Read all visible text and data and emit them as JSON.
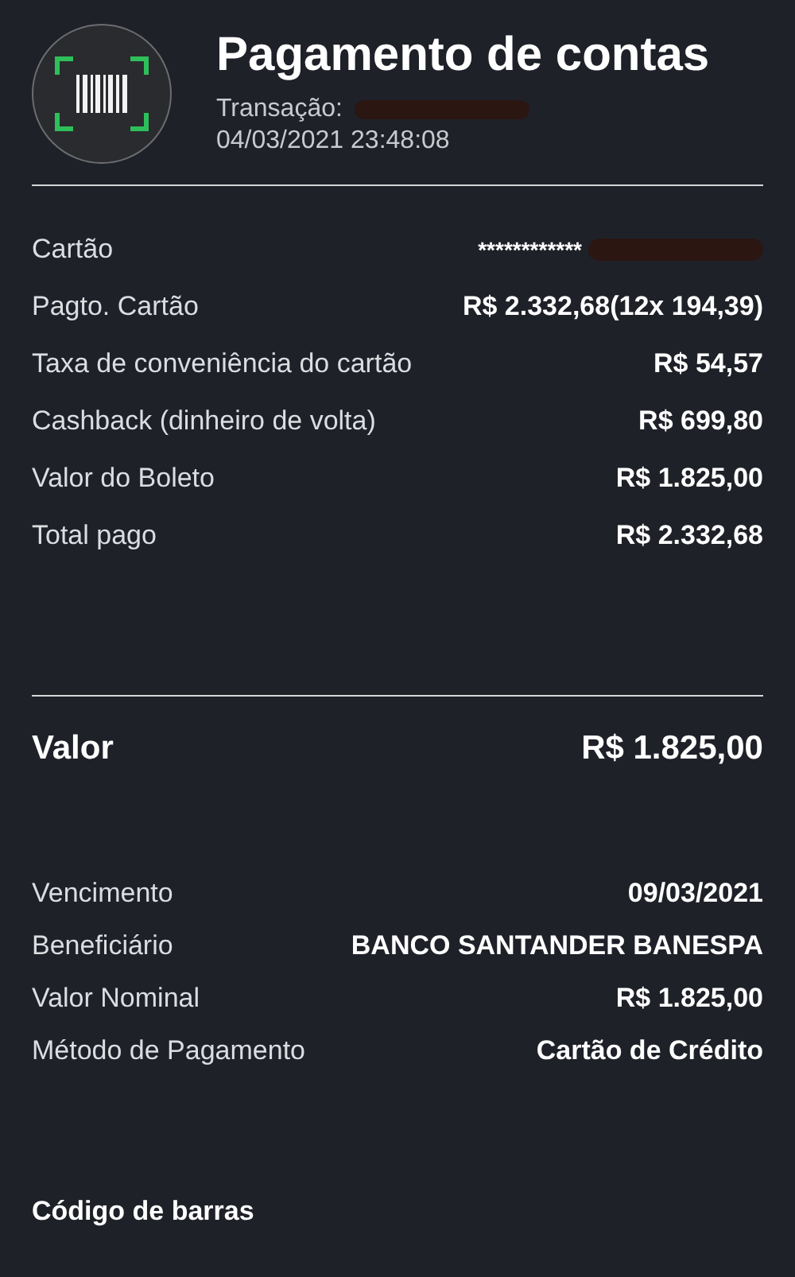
{
  "header": {
    "title": "Pagamento de contas",
    "transaction_label": "Transação:",
    "datetime": "04/03/2021 23:48:08"
  },
  "payment_rows": [
    {
      "label": "Cartão",
      "value": "************",
      "redacted": true
    },
    {
      "label": "Pagto. Cartão",
      "value": "R$ 2.332,68(12x 194,39)",
      "redacted": false
    },
    {
      "label": "Taxa de conveniência do cartão",
      "value": "R$ 54,57",
      "redacted": false
    },
    {
      "label": "Cashback (dinheiro de volta)",
      "value": "R$ 699,80",
      "redacted": false
    },
    {
      "label": "Valor do Boleto",
      "value": "R$ 1.825,00",
      "redacted": false
    },
    {
      "label": "Total pago",
      "value": "R$ 2.332,68",
      "redacted": false
    }
  ],
  "total": {
    "label": "Valor",
    "value": "R$ 1.825,00"
  },
  "bill_rows": [
    {
      "label": "Vencimento",
      "value": "09/03/2021"
    },
    {
      "label": "Beneficiário",
      "value": "BANCO SANTANDER BANESPA"
    },
    {
      "label": "Valor Nominal",
      "value": "R$ 1.825,00"
    },
    {
      "label": "Método de Pagamento",
      "value": "Cartão de Crédito"
    }
  ],
  "barcode_section": {
    "title": "Código de barras"
  }
}
